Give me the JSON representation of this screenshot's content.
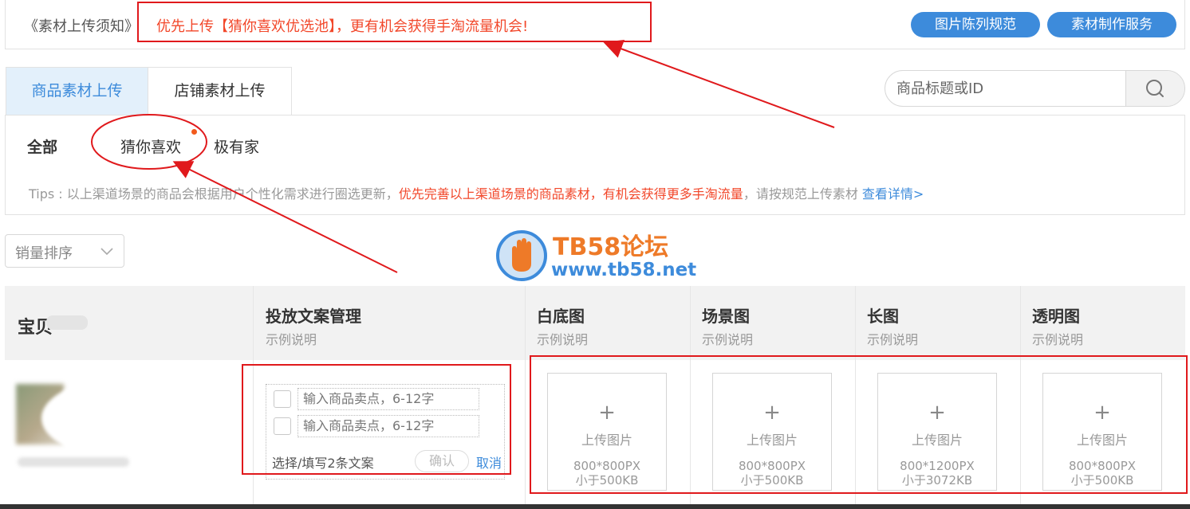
{
  "notice": {
    "prefix": "《素材上传须知》",
    "highlight": "优先上传【猜你喜欢优选池】，更有机会获得手淘流量机会!",
    "btn_spec": "图片陈列规范",
    "btn_service": "素材制作服务"
  },
  "tabs": [
    "商品素材上传",
    "店铺素材上传"
  ],
  "search": {
    "placeholder": "商品标题或ID",
    "icon": "search-icon"
  },
  "filters": [
    "全部",
    "猜你喜欢",
    "极有家"
  ],
  "tips": {
    "pre": "Tips : 以上渠道场景的商品会根据用户个性化需求进行圈选更新，",
    "red": "优先完善以上渠道场景的商品素材，有机会获得更多手淘流量",
    "post": "，请按规范上传素材 ",
    "link": "查看详情>"
  },
  "sort": {
    "label": "销量排序",
    "icon": "chevron-down-icon"
  },
  "watermark": {
    "title": "TB58论坛",
    "url": "www.tb58.net"
  },
  "table": {
    "columns": [
      {
        "title": "宝贝",
        "sub": ""
      },
      {
        "title": "投放文案管理",
        "sub": "示例说明"
      },
      {
        "title": "白底图",
        "sub": "示例说明"
      },
      {
        "title": "场景图",
        "sub": "示例说明"
      },
      {
        "title": "长图",
        "sub": "示例说明"
      },
      {
        "title": "透明图",
        "sub": "示例说明"
      }
    ],
    "copy": {
      "placeholder1": "输入商品卖点，6-12字",
      "placeholder2": "输入商品卖点，6-12字",
      "hint": "选择/填写2条文案",
      "confirm": "确认",
      "cancel": "取消"
    },
    "uploads": [
      {
        "plus": "+",
        "label": "上传图片",
        "size": "800*800PX",
        "limit": "小于500KB"
      },
      {
        "plus": "+",
        "label": "上传图片",
        "size": "800*800PX",
        "limit": "小于500KB"
      },
      {
        "plus": "+",
        "label": "上传图片",
        "size": "800*1200PX",
        "limit": "小于3072KB"
      },
      {
        "plus": "+",
        "label": "上传图片",
        "size": "800*800PX",
        "limit": "小于500KB"
      }
    ]
  },
  "colors": {
    "accent": "#3d8bdb",
    "highlight": "#f2472a",
    "annotation": "#e0191c"
  }
}
